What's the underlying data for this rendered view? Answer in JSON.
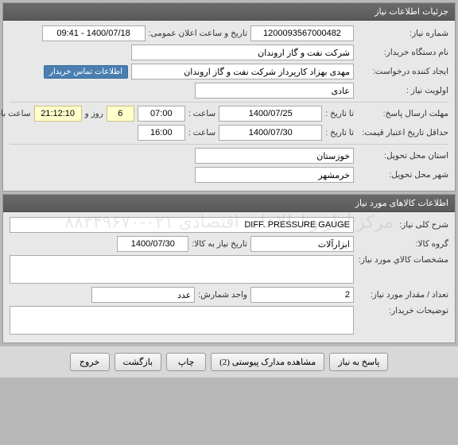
{
  "panel1": {
    "title": "جزئیات اطلاعات نیاز",
    "needNumberLabel": "شماره نیاز:",
    "needNumber": "1200093567000482",
    "announceLabel": "تاریخ و ساعت اعلان عمومی:",
    "announceValue": "1400/07/18 - 09:41",
    "buyerLabel": "نام دستگاه خریدار:",
    "buyerValue": "شرکت نفت و گاز اروندان",
    "creatorLabel": "ایجاد کننده درخواست:",
    "creatorValue": "مهدی بهزاد کارپرداز شرکت نفت و گاز اروندان",
    "contactBuyerBtn": "اطلاعات تماس خریدار",
    "priorityLabel": "اولویت نیاز :",
    "priorityValue": "عادی",
    "deadlineLabel": "مهلت ارسال پاسخ:",
    "tillDateLabel": "تا تاریخ :",
    "deadlineDate": "1400/07/25",
    "timeLabel": "ساعت :",
    "deadlineTime": "07:00",
    "daysValue": "6",
    "daysLabel": "روز و",
    "remainTime": "21:12:10",
    "remainLabel": "ساعت باقی مانده",
    "validityLabel": "حداقل تاریخ اعتبار قیمت:",
    "validityDate": "1400/07/30",
    "validityTime": "16:00",
    "provinceLabel": "استان محل تحویل:",
    "provinceValue": "خوزستان",
    "cityLabel": "شهر محل تحویل:",
    "cityValue": "خرمشهر"
  },
  "panel2": {
    "title": "اطلاعات کالاهای مورد نیاز",
    "descLabel": "شرح کلی نیاز:",
    "descValue": "DIFF. PRESSURE GAUGE",
    "groupLabel": "گروه کالا:",
    "groupValue": "ابزارآلات",
    "needDateLabel": "تاریخ نیاز به کالا:",
    "needDateValue": "1400/07/30",
    "specLabel": "مشخصات كالاي مورد نیاز:",
    "specValue": "",
    "qtyLabel": "تعداد / مقدار مورد نیاز:",
    "qtyValue": "2",
    "unitLabel": "واحد شمارش:",
    "unitValue": "عدد",
    "buyerNoteLabel": "توضیحات خریدار:",
    "buyerNoteValue": ""
  },
  "footer": {
    "respond": "پاسخ به نیاز",
    "attachments": "مشاهده مدارک پیوستی (2)",
    "print": "چاپ",
    "back": "بازگشت",
    "exit": "خروج"
  },
  "watermark": "مرکز آمار و اطلاعات اقتصادی\n۰۲۱-۸۸۳۴۹۶۷۰"
}
